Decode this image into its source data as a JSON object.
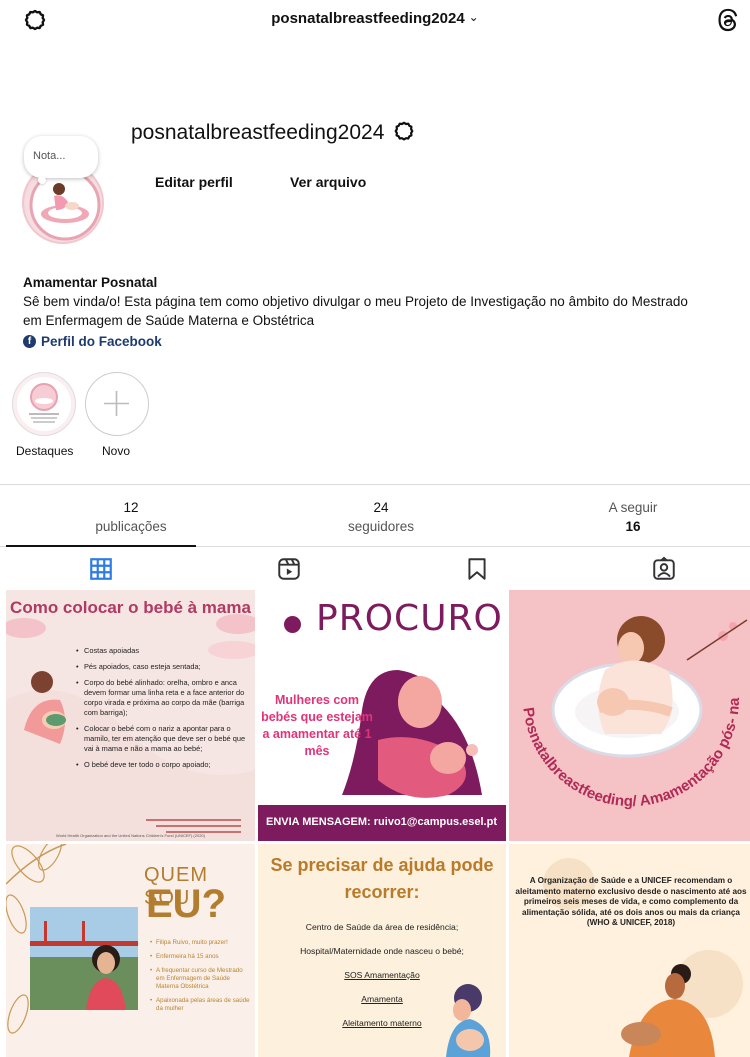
{
  "header": {
    "account_name": "posnatalbreastfeeding2024",
    "settings_icon": "gear-icon",
    "threads_icon": "threads-icon"
  },
  "profile": {
    "note_placeholder": "Nota...",
    "username": "posnatalbreastfeeding2024",
    "edit_profile_label": "Editar perfil",
    "archive_label": "Ver arquivo",
    "display_name": "Amamentar Posnatal",
    "bio_line1": "Sê bem vinda/o! Esta página tem como objetivo divulgar o meu Projeto de Investigação no âmbito do Mestrado",
    "bio_line2": "em Enfermagem de Saúde Materna e Obstétrica",
    "facebook_link": "Perfil do Facebook"
  },
  "highlights": [
    {
      "label": "Destaques"
    },
    {
      "label": "Novo"
    }
  ],
  "stats": {
    "posts": {
      "value": "12",
      "label": "publicações"
    },
    "followers": {
      "value": "24",
      "label": "seguidores"
    },
    "following": {
      "value": "16",
      "label": "A seguir"
    }
  },
  "tabs": [
    "grid-icon",
    "reels-icon",
    "saved-icon",
    "tagged-icon"
  ],
  "posts": {
    "p1": {
      "title": "Como colocar o bebé à mama",
      "items": [
        "Costas apoiadas",
        "Pés apoiados, caso esteja sentada;",
        "Corpo do bebé alinhado: orelha, ombro e anca devem formar uma linha reta e a face anterior do corpo virada e próxima ao corpo da mãe (barriga com barriga);",
        "Colocar o bebé com o nariz a apontar para o mamilo, ter em atenção que deve ser o bebé que vai à mama e não a mama ao bebé;",
        "O bebé deve ter todo o corpo apoiado;"
      ],
      "footer": "World Health Organization and the United Nations Children's Fund (UNICEF) (2020)"
    },
    "p2": {
      "title": "PROCURO",
      "text": "Mulheres com bebés que estejam a amamentar até 1 mês",
      "band": "ENVIA MENSAGEM: ruivo1@campus.esel.pt"
    },
    "p3": {
      "caption": "Posnatalbreastfeeding/ Amamentação pós- natal"
    },
    "p4": {
      "title1": "QUEM SOU",
      "title2": "EU?",
      "items": [
        "Filipa Ruivo, muito prazer!",
        "Enfermeira há 15 anos",
        "A frequentar curso de Mestrado em Enfermagem de Saúde Materna Obstétrica",
        "Apaixonada pelas áreas de saúde da mulher"
      ]
    },
    "p5": {
      "title": "Se precisar de ajuda pode recorrer:",
      "lines": [
        "Centro de Saúde da área de residência;",
        "Hospital/Maternidade onde nasceu o bebé;",
        "SOS Amamentação",
        "Amamenta",
        "Aleitamento materno"
      ]
    },
    "p6": {
      "text": "A Organização de Saúde e a UNICEF recomendam o aleitamento materno exclusivo desde o nascimento até aos primeiros seis meses de vida, e como complemento da alimentação sólida, até os dois anos ou mais da criança",
      "source": "(WHO & UNICEF, 2018)"
    }
  },
  "colors": {
    "accent_pink": "#e0337a",
    "plum": "#7d1b5e",
    "link_blue": "#1f3a6e"
  }
}
